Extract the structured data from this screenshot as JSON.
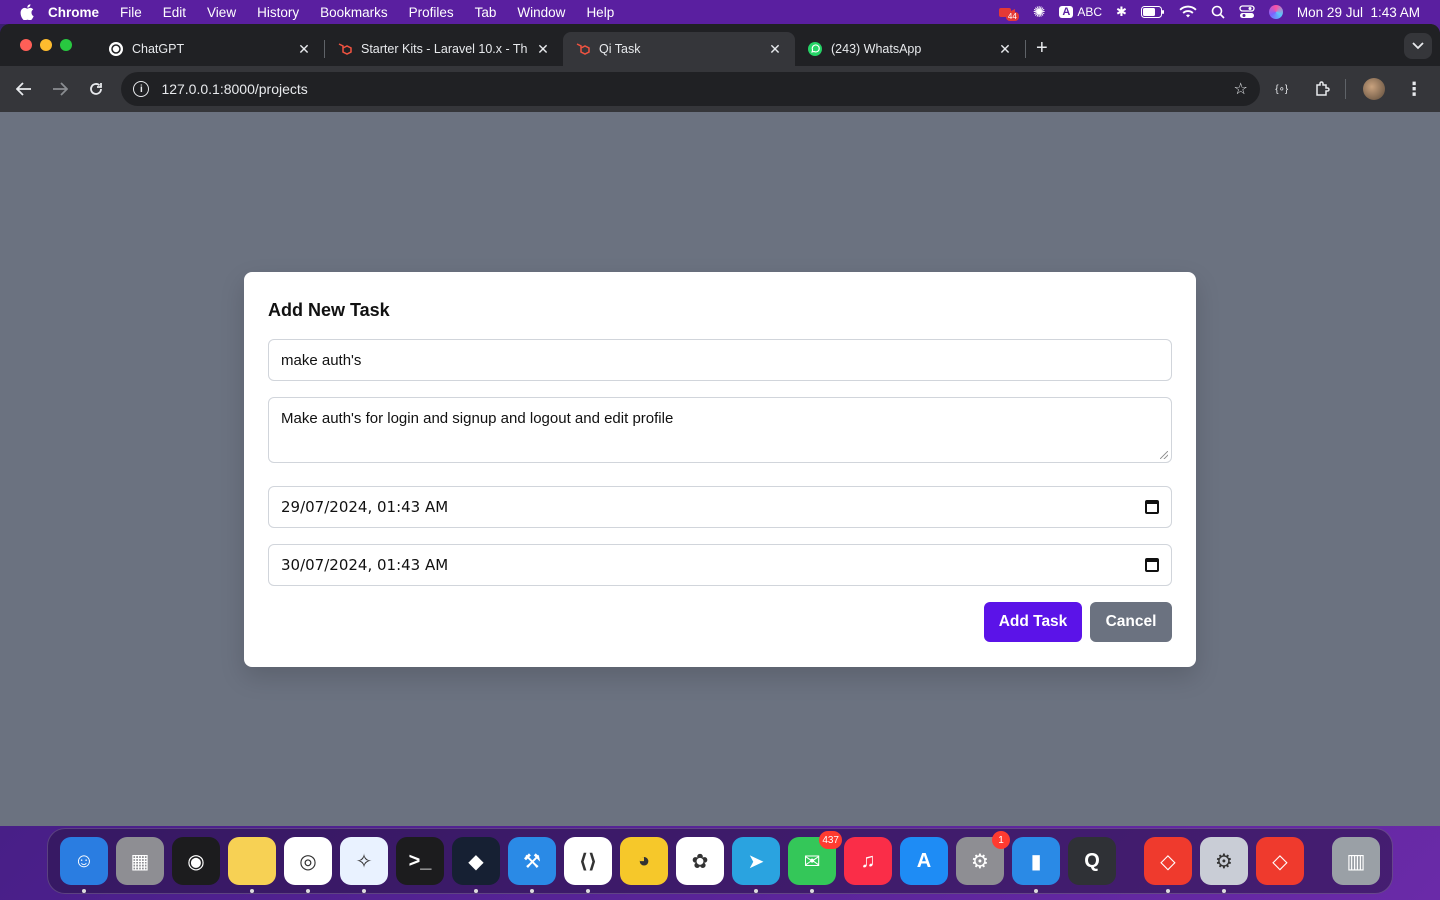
{
  "menubar": {
    "app_name": "Chrome",
    "items": [
      "File",
      "Edit",
      "View",
      "History",
      "Bookmarks",
      "Profiles",
      "Tab",
      "Window",
      "Help"
    ],
    "input_source": "ABC",
    "rec_badge": "44",
    "datetime": "Mon 29 Jul  1:43 AM"
  },
  "tabs": [
    {
      "title": "ChatGPT",
      "favicon": "openai-icon",
      "active": false
    },
    {
      "title": "Starter Kits - Laravel 10.x - Th",
      "favicon": "laravel-icon",
      "active": false
    },
    {
      "title": "Qi Task",
      "favicon": "laravel-icon",
      "active": true
    },
    {
      "title": "(243) WhatsApp",
      "favicon": "whatsapp-icon",
      "active": false
    }
  ],
  "toolbar": {
    "url": "127.0.0.1:8000/projects"
  },
  "modal": {
    "title": "Add New Task",
    "task_name_value": "make auth's",
    "description_value": "Make auth's for login and signup and logout and edit profile",
    "start_date_value": "29/07/2024, 01:43 AM",
    "end_date_value": "30/07/2024, 01:43 AM",
    "add_button": "Add Task",
    "cancel_button": "Cancel"
  },
  "colors": {
    "primary": "#5b13e8",
    "secondary": "#6b7280",
    "overlay": "#6b7280"
  },
  "dock": {
    "apps": [
      {
        "name": "finder-icon",
        "color": "#2a7de1"
      },
      {
        "name": "launchpad-icon",
        "color": "#8e8e93"
      },
      {
        "name": "siri-icon",
        "color": "#1c1c1e"
      },
      {
        "name": "notes-icon",
        "color": "#f7d154"
      },
      {
        "name": "chrome-icon",
        "color": "#ffffff"
      },
      {
        "name": "safari-icon",
        "color": "#e9f2ff"
      },
      {
        "name": "terminal-icon",
        "color": "#1c1c1e"
      },
      {
        "name": "cursor-icon",
        "color": "#162033"
      },
      {
        "name": "xcode-icon",
        "color": "#2a8ae6"
      },
      {
        "name": "vscode-icon",
        "color": "#ffffff"
      },
      {
        "name": "cyberduck-icon",
        "color": "#f6c82a"
      },
      {
        "name": "photos-icon",
        "color": "#ffffff"
      },
      {
        "name": "telegram-icon",
        "color": "#2aa3e0"
      },
      {
        "name": "messages-icon",
        "color": "#34c759",
        "badge": "437"
      },
      {
        "name": "music-icon",
        "color": "#fa2d48"
      },
      {
        "name": "app-store-icon",
        "color": "#1e8cf5"
      },
      {
        "name": "system-settings-icon",
        "color": "#8e8e93",
        "badge": "1"
      },
      {
        "name": "simulator-icon",
        "color": "#2a8ae6"
      },
      {
        "name": "quicktime-icon",
        "color": "#2f3136"
      },
      {
        "name": "anydesk-icon",
        "color": "#ef3a2d"
      },
      {
        "name": "settings-gear-icon",
        "color": "#c9cdd6"
      },
      {
        "name": "anydesk-icon-2",
        "color": "#ef3a2d"
      },
      {
        "name": "trash-icon",
        "color": "#9aa0a6"
      }
    ]
  }
}
